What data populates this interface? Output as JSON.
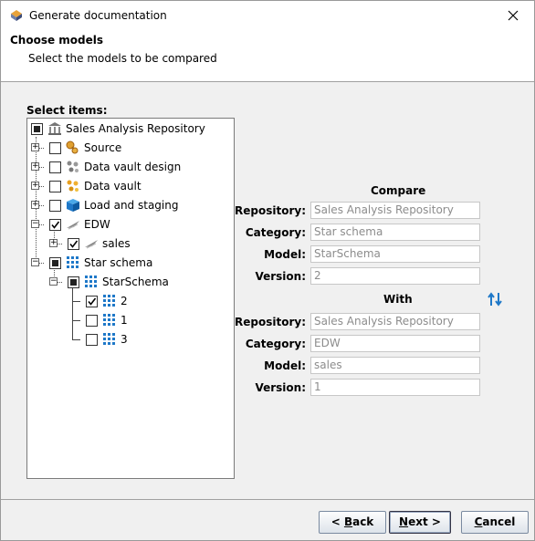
{
  "window": {
    "title": "Generate documentation"
  },
  "header": {
    "title": "Choose models",
    "subtitle": "Select the models to be compared"
  },
  "tree": {
    "label": "Select items:",
    "root": "Sales Analysis Repository",
    "items": {
      "source": "Source",
      "dv_design": "Data vault design",
      "data_vault": "Data vault",
      "load_staging": "Load and staging",
      "edw": "EDW",
      "sales": "sales",
      "star_schema": "Star schema",
      "starschema_model": "StarSchema",
      "v2": "2",
      "v1": "1",
      "v3": "3"
    }
  },
  "compare": {
    "title": "Compare",
    "repository_label": "Repository:",
    "category_label": "Category:",
    "model_label": "Model:",
    "version_label": "Version:",
    "repository": "Sales Analysis Repository",
    "category": "Star schema",
    "model": "StarSchema",
    "version": "2"
  },
  "with": {
    "title": "With",
    "repository_label": "Repository:",
    "category_label": "Category:",
    "model_label": "Model:",
    "version_label": "Version:",
    "repository": "Sales Analysis Repository",
    "category": "EDW",
    "model": "sales",
    "version": "1"
  },
  "buttons": {
    "back": "< Back",
    "back_mnemonic": "B",
    "next": "Next >",
    "next_mnemonic": "N",
    "cancel": "Cancel",
    "cancel_mnemonic": "C"
  },
  "colors": {
    "field_text": "#8c8c8c",
    "accent": "#1e78c8"
  }
}
